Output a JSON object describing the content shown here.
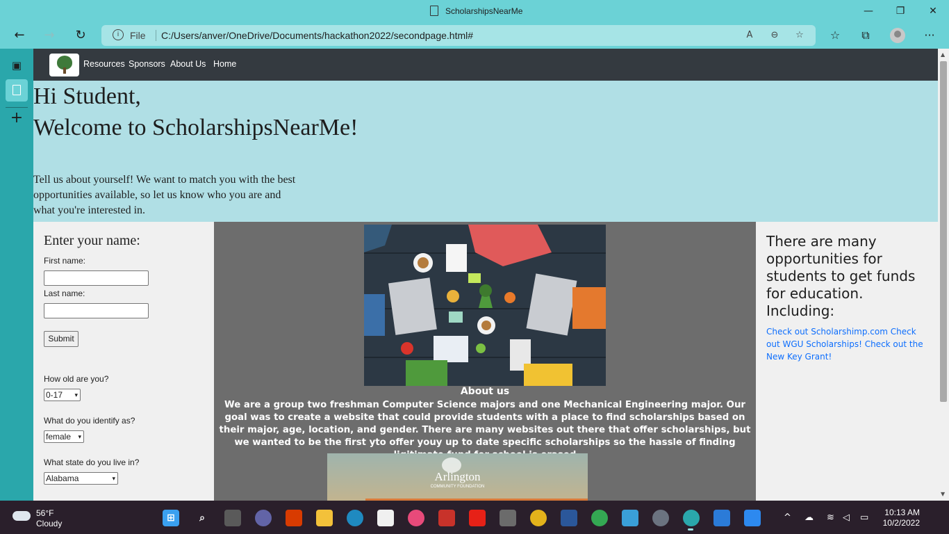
{
  "window": {
    "title": "ScholarshipsNearMe",
    "minimize": "—",
    "restore": "❐",
    "close": "✕"
  },
  "toolbar": {
    "back": "←",
    "forward": "→",
    "refresh": "↻",
    "info_glyph": "i",
    "file_label": "File",
    "url": "C:/Users/anver/OneDrive/Documents/hackathon2022/secondpage.html#",
    "read_aloud": "A",
    "zoom_out": "⊖",
    "favorite_add": "☆",
    "favorites": "☆",
    "collections": "⧉",
    "more": "···"
  },
  "sidebar": {
    "tab_actions": "▣",
    "new_tab": "+"
  },
  "site": {
    "nav": [
      "Resources",
      "Sponsors",
      "About Us",
      "Home"
    ],
    "hero_line1": "Hi Student,",
    "hero_line2": "Welcome to ScholarshipsNearMe!",
    "hero_paragraph": "Tell us about yourself! We want to match you with the best opportunities available, so let us know who you are and what you're interested in.",
    "form": {
      "heading": "Enter your name:",
      "first_name_label": "First name:",
      "last_name_label": "Last name:",
      "first_name_value": "",
      "last_name_value": "",
      "submit": "Submit",
      "age_label": "How old are you?",
      "age_value": "0-17",
      "identity_label": "What do you identify as?",
      "identity_value": "female",
      "state_label": "What state do you live in?",
      "state_value": "Alabama",
      "caret": "▾"
    },
    "about": {
      "title": "About us",
      "body": "We are a group two freshman Computer Science majors and one Mechanical Engineering major. Our goal was to create a website that could provide students with a place to find scholarships based on their major, age, location, and gender. There are many websites out there that offer scholarships, but we wanted to be the first yto offer youy up to date specific scholarships so the hassle of finding ligitimate fund for school is erased"
    },
    "sponsor": {
      "name": "Arlington",
      "subtitle": "COMMUNITY FOUNDATION"
    },
    "right": {
      "heading": "There are many opportunities for students to get funds for education. Including:",
      "links": "Check out Scholarshimp.com Check out WGU Scholarships! Check out the New Key Grant!"
    }
  },
  "taskbar": {
    "temp": "56°F",
    "condition": "Cloudy",
    "time": "10:13 AM",
    "date": "10/2/2022",
    "chevron": "^"
  }
}
